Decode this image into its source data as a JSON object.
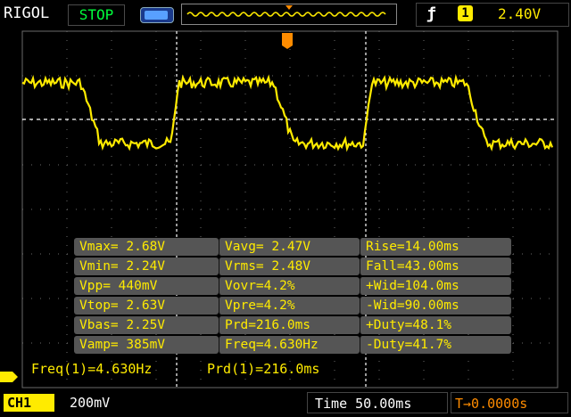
{
  "header": {
    "brand": "RIGOL",
    "run_state": "STOP",
    "trigger_source": "1",
    "trigger_level": "2.40V",
    "trigger_edge_icon": "rising-edge-icon"
  },
  "measurements": {
    "rows": [
      [
        "Vmax= 2.68V",
        "Vavg= 2.47V",
        "Rise=14.00ms"
      ],
      [
        "Vmin= 2.24V",
        "Vrms= 2.48V",
        "Fall=43.00ms"
      ],
      [
        "Vpp= 440mV",
        "Vovr=4.2%",
        "+Wid=104.0ms"
      ],
      [
        "Vtop= 2.63V",
        "Vpre=4.2%",
        "-Wid=90.00ms"
      ],
      [
        "Vbas= 2.25V",
        "Prd=216.0ms",
        "+Duty=48.1%"
      ],
      [
        "Vamp= 385mV",
        "Freq=4.630Hz",
        "-Duty=41.7%"
      ]
    ]
  },
  "counter": {
    "freq": "Freq(1)=4.630Hz",
    "prd": "Prd(1)=216.0ms"
  },
  "footer": {
    "channel": "CH1",
    "volts_div": "200mV",
    "time_div": "Time 50.00ms",
    "trigger_offset": "T→0.0000s"
  },
  "colors": {
    "trace": "#ffeb00",
    "stop": "#00ff3c",
    "trigger_marker": "#ff8c00",
    "background": "#000000"
  }
}
